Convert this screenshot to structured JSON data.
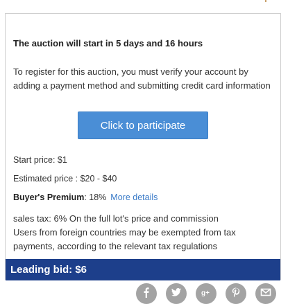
{
  "auction": {
    "countdown": "The auction will start in 5 days and 16 hours",
    "register_notice": "To register for this auction, you must verify your account by adding a payment method and submitting credit card information",
    "participate_label": "Click to participate",
    "start_price": "Start price: $1",
    "estimated_price": "Estimated price : $20 - $40",
    "buyers_premium_label": "Buyer's Premium",
    "buyers_premium_value": ": 18%",
    "more_details_label": "More details",
    "tax_line_1": "sales tax: 6% On the full lot's price and commission",
    "tax_line_2": "Users from foreign countries may be exempted from tax payments, according to the relevant tax regulations",
    "leading_bid": "Leading bid: $6"
  },
  "share_icons": [
    "facebook-icon",
    "twitter-icon",
    "google-plus-icon",
    "pinterest-icon",
    "email-icon"
  ],
  "colors": {
    "accent_button": "#4a8ed6",
    "leading_bar": "#1d3f8b",
    "link": "#3a7bc8",
    "share_icon": "#a3a3a3"
  }
}
